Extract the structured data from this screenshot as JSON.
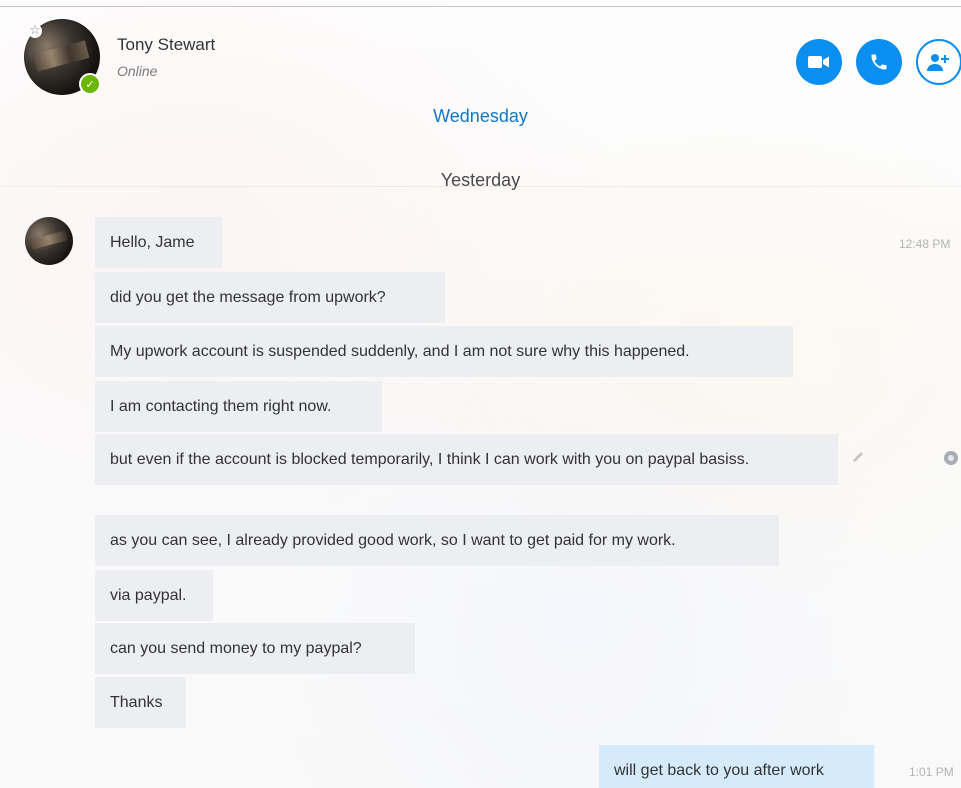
{
  "header": {
    "contact_name": "Tony Stewart",
    "contact_status": "Online",
    "icons": {
      "favorite": "star-icon",
      "presence": "checkmark-icon",
      "video": "video-camera-icon",
      "call": "phone-icon",
      "add_people": "add-person-icon"
    },
    "accent_color": "#0a8ef0",
    "presence_color": "#6bb700"
  },
  "separators": {
    "wednesday": "Wednesday",
    "yesterday": "Yesterday"
  },
  "messages": [
    {
      "text": "Hello, Jame"
    },
    {
      "text": "did you get the message from upwork?"
    },
    {
      "text": "My upwork account is suspended suddenly, and I am not sure why this happened."
    },
    {
      "text": "I am contacting them right now."
    },
    {
      "text": "but even if the account is blocked temporarily, I think I can work with you on paypal basiss."
    },
    {
      "text": "as you can see, I already provided good work, so I want to get paid for my work."
    },
    {
      "text": "via paypal."
    },
    {
      "text": "can you send money to my paypal?"
    },
    {
      "text": "Thanks"
    }
  ],
  "incoming_timestamp": "12:48 PM",
  "outgoing": {
    "text": "will get back to you after work",
    "timestamp": "1:01 PM"
  },
  "colors": {
    "incoming_bubble": "#eceef2",
    "outgoing_bubble": "#d5ebfb",
    "link_text": "#1178c4"
  }
}
